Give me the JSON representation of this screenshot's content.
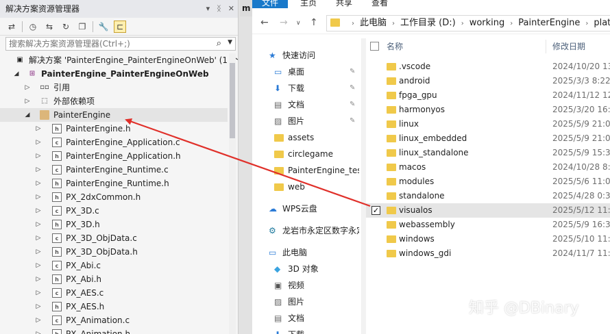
{
  "vs": {
    "title": "解决方案资源管理器",
    "search_placeholder": "搜索解决方案资源管理器(Ctrl+;)",
    "tree": [
      {
        "label": "解决方案 'PainterEngine_PainterEngineOnWeb' (1 个",
        "level": 0,
        "icon": "solution-icon",
        "expand": ""
      },
      {
        "label": "PainterEngine_PainterEngineOnWeb",
        "level": 0,
        "icon": "project-icon",
        "expand": "◢",
        "bold": true
      },
      {
        "label": "引用",
        "level": 1,
        "icon": "references-icon",
        "expand": "▷"
      },
      {
        "label": "外部依赖项",
        "level": 1,
        "icon": "external-deps-icon",
        "expand": "▷"
      },
      {
        "label": "PainterEngine",
        "level": 1,
        "icon": "filter-folder-icon",
        "expand": "◢",
        "highlight": true
      },
      {
        "label": "PainterEngine.h",
        "level": 2,
        "icon": "header-file-icon",
        "expand": "▷"
      },
      {
        "label": "PainterEngine_Application.c",
        "level": 2,
        "icon": "c-file-icon",
        "expand": "▷"
      },
      {
        "label": "PainterEngine_Application.h",
        "level": 2,
        "icon": "header-file-icon",
        "expand": "▷"
      },
      {
        "label": "PainterEngine_Runtime.c",
        "level": 2,
        "icon": "c-file-icon",
        "expand": "▷"
      },
      {
        "label": "PainterEngine_Runtime.h",
        "level": 2,
        "icon": "header-file-icon",
        "expand": "▷"
      },
      {
        "label": "PX_2dxCommon.h",
        "level": 2,
        "icon": "header-file-icon",
        "expand": "▷"
      },
      {
        "label": "PX_3D.c",
        "level": 2,
        "icon": "c-file-icon",
        "expand": "▷"
      },
      {
        "label": "PX_3D.h",
        "level": 2,
        "icon": "header-file-icon",
        "expand": "▷"
      },
      {
        "label": "PX_3D_ObjData.c",
        "level": 2,
        "icon": "c-file-icon",
        "expand": "▷"
      },
      {
        "label": "PX_3D_ObjData.h",
        "level": 2,
        "icon": "header-file-icon",
        "expand": "▷"
      },
      {
        "label": "PX_Abi.c",
        "level": 2,
        "icon": "c-file-icon",
        "expand": "▷"
      },
      {
        "label": "PX_Abi.h",
        "level": 2,
        "icon": "header-file-icon",
        "expand": "▷"
      },
      {
        "label": "PX_AES.c",
        "level": 2,
        "icon": "c-file-icon",
        "expand": "▷"
      },
      {
        "label": "PX_AES.h",
        "level": 2,
        "icon": "header-file-icon",
        "expand": "▷"
      },
      {
        "label": "PX_Animation.c",
        "level": 2,
        "icon": "c-file-icon",
        "expand": "▷"
      },
      {
        "label": "PX_Animation.h",
        "level": 2,
        "icon": "header-file-icon",
        "expand": "▷"
      }
    ]
  },
  "mid": {
    "tab_letter": "m"
  },
  "fx": {
    "ribbon": {
      "tabs": [
        "文件",
        "主页",
        "共享",
        "查看"
      ]
    },
    "breadcrumb": [
      "此电脑",
      "工作目录 (D:)",
      "working",
      "PainterEngine",
      "platfor"
    ],
    "nav_items": [
      {
        "label": "快速访问",
        "icon": "star-icon",
        "indent": 0,
        "pin": false
      },
      {
        "label": "桌面",
        "icon": "desktop-icon",
        "indent": 1,
        "pin": true
      },
      {
        "label": "下载",
        "icon": "download-icon",
        "indent": 1,
        "pin": true
      },
      {
        "label": "文档",
        "icon": "document-icon",
        "indent": 1,
        "pin": true
      },
      {
        "label": "图片",
        "icon": "picture-icon",
        "indent": 1,
        "pin": true
      },
      {
        "label": "assets",
        "icon": "folder-icon",
        "indent": 1,
        "pin": false
      },
      {
        "label": "circlegame",
        "icon": "folder-icon",
        "indent": 1,
        "pin": false
      },
      {
        "label": "PainterEngine_test",
        "icon": "folder-icon",
        "indent": 1,
        "pin": false
      },
      {
        "label": "web",
        "icon": "folder-icon",
        "indent": 1,
        "pin": false
      },
      {
        "label": "WPS云盘",
        "icon": "cloud-icon",
        "indent": 0,
        "pin": false
      },
      {
        "label": "龙岩市永定区数字永定",
        "icon": "network-icon",
        "indent": 0,
        "pin": false
      },
      {
        "label": "此电脑",
        "icon": "computer-icon",
        "indent": 0,
        "pin": false
      },
      {
        "label": "3D 对象",
        "icon": "3d-objects-icon",
        "indent": 1,
        "pin": false
      },
      {
        "label": "视频",
        "icon": "video-icon",
        "indent": 1,
        "pin": false
      },
      {
        "label": "图片",
        "icon": "picture-icon",
        "indent": 1,
        "pin": false
      },
      {
        "label": "文档",
        "icon": "document-icon",
        "indent": 1,
        "pin": false
      },
      {
        "label": "下载",
        "icon": "download-icon",
        "indent": 1,
        "pin": false
      }
    ],
    "header": {
      "name": "名称",
      "date": "修改日期"
    },
    "files": [
      {
        "name": ".vscode",
        "date": "2024/10/20 13"
      },
      {
        "name": "android",
        "date": "2025/3/3 8:22"
      },
      {
        "name": "fpga_gpu",
        "date": "2024/11/12 12"
      },
      {
        "name": "harmonyos",
        "date": "2025/3/20 16:3"
      },
      {
        "name": "linux",
        "date": "2025/5/9 21:02"
      },
      {
        "name": "linux_embedded",
        "date": "2025/5/9 21:02"
      },
      {
        "name": "linux_standalone",
        "date": "2025/5/9 15:32"
      },
      {
        "name": "macos",
        "date": "2024/10/28 8:2"
      },
      {
        "name": "modules",
        "date": "2025/5/6 11:07"
      },
      {
        "name": "standalone",
        "date": "2025/4/28 0:31"
      },
      {
        "name": "visualos",
        "date": "2025/5/12 11:0",
        "selected": true
      },
      {
        "name": "webassembly",
        "date": "2025/5/9 16:30"
      },
      {
        "name": "windows",
        "date": "2025/5/10 11:3"
      },
      {
        "name": "windows_gdi",
        "date": "2024/11/7 11:0"
      }
    ]
  },
  "watermark": "知乎 @DBinary",
  "colors": {
    "accent": "#1979ca",
    "arrow": "#e0302a",
    "folder": "#f0c94a"
  }
}
